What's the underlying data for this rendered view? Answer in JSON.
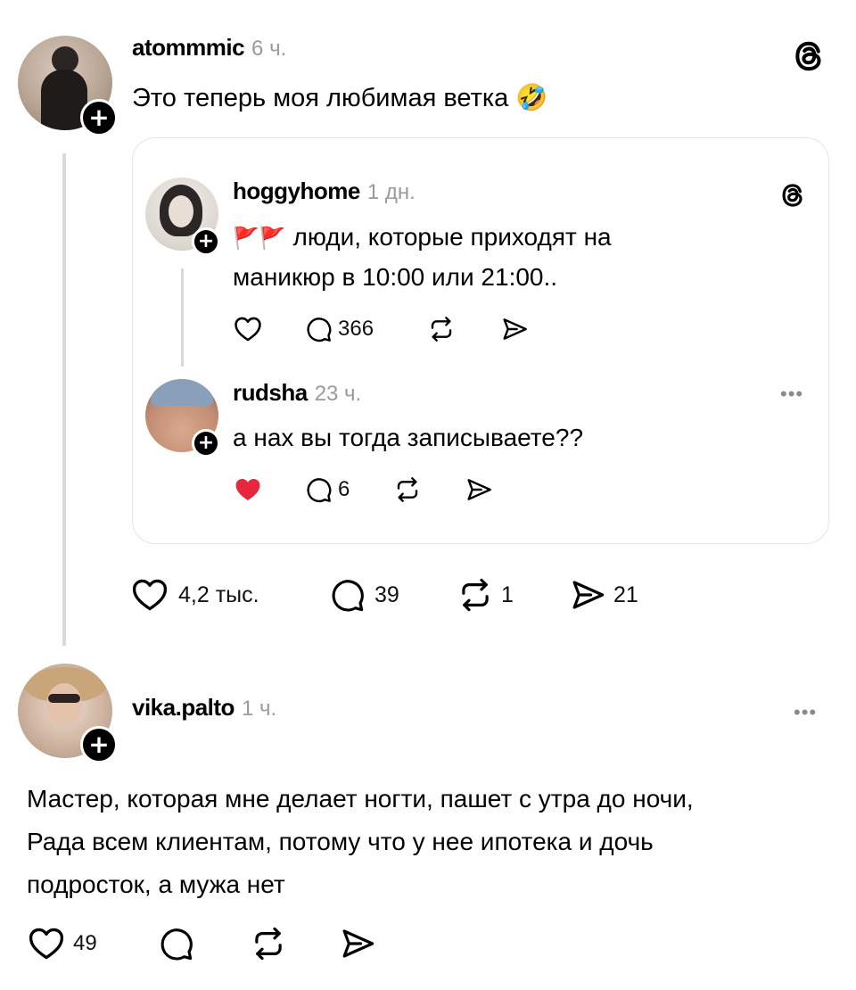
{
  "post": {
    "username": "atommmic",
    "time": "6 ч.",
    "text": "Это теперь моя любимая ветка 🤣",
    "actions": {
      "likes": "4,2 тыс.",
      "comments": "39",
      "reposts": "1",
      "shares": "21"
    }
  },
  "quoted": {
    "post": {
      "username": "hoggyhome",
      "time": "1 дн.",
      "flags": "🚩🚩",
      "text_line1": "люди, которые приходят на",
      "text_line2": "маникюр в 10:00 или 21:00..",
      "comments": "366"
    },
    "reply": {
      "username": "rudsha",
      "time": "23 ч.",
      "text": "а нах вы тогда записываете??",
      "comments": "6",
      "liked": true
    }
  },
  "comment": {
    "username": "vika.palto",
    "time": "1 ч.",
    "text_line1": "Мастер, которая мне делает ногти, пашет с утра до ночи,",
    "text_line2": "Рада всем клиентам, потому что у нее ипотека и дочь",
    "text_line3": "подросток, а мужа нет",
    "likes": "49"
  },
  "icons": {
    "threads": "threads-logo-icon",
    "like": "heart-icon",
    "comment": "comment-bubble-icon",
    "repost": "repost-icon",
    "share": "send-icon",
    "more": "more-dots-icon",
    "follow": "plus-icon"
  },
  "colors": {
    "like_active": "#e8263f",
    "muted": "#9a9a9a",
    "divider": "#d9d9d9"
  }
}
